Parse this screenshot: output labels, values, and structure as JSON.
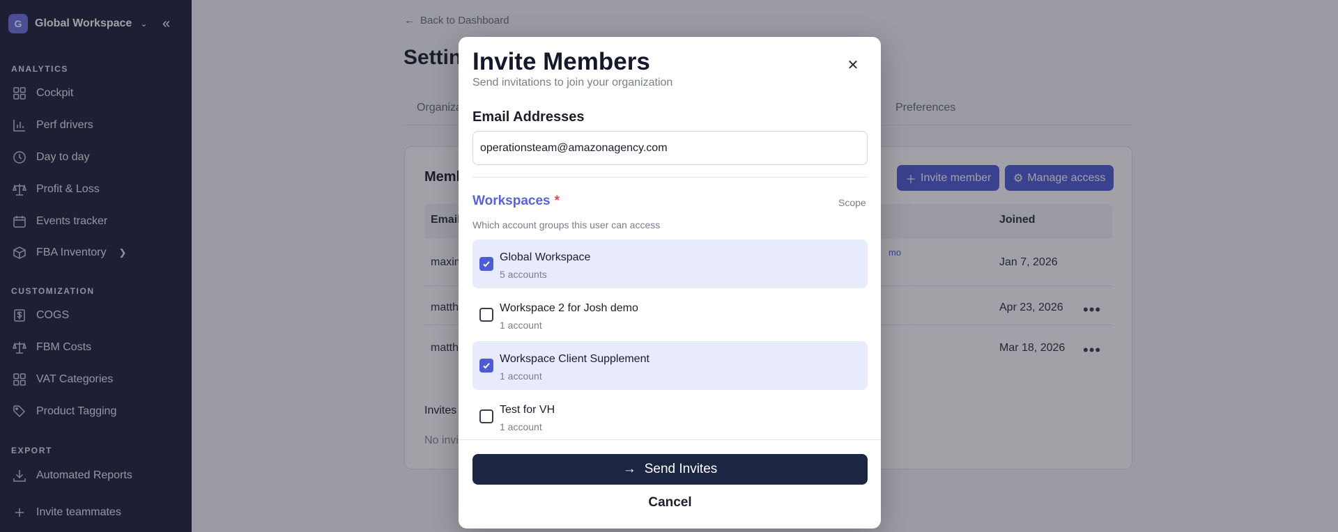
{
  "sidebar": {
    "workspace": {
      "initial": "G",
      "name": "Global Workspace"
    },
    "sections": [
      {
        "label": "ANALYTICS",
        "items": [
          {
            "label": "Cockpit",
            "icon": "grid-icon"
          },
          {
            "label": "Perf drivers",
            "icon": "bar-chart-icon"
          },
          {
            "label": "Day to day",
            "icon": "clock-icon"
          },
          {
            "label": "Profit & Loss",
            "icon": "scale-icon"
          },
          {
            "label": "Events tracker",
            "icon": "calendar-icon"
          },
          {
            "label": "FBA Inventory",
            "icon": "box-icon"
          }
        ]
      },
      {
        "label": "CUSTOMIZATION",
        "items": [
          {
            "label": "COGS",
            "icon": "dollar-icon"
          },
          {
            "label": "FBM Costs",
            "icon": "scale-icon"
          },
          {
            "label": "VAT Categories",
            "icon": "grid-icon"
          },
          {
            "label": "Product Tagging",
            "icon": "tag-icon"
          }
        ]
      },
      {
        "label": "EXPORT",
        "items": [
          {
            "label": "Automated Reports",
            "icon": "download-icon"
          }
        ]
      }
    ],
    "footer": {
      "label": "Invite teammates",
      "icon": "plus-icon"
    }
  },
  "page": {
    "back_link": "Back to Dashboard",
    "title": "Setting",
    "tabs": [
      "Organiza",
      "Preferences"
    ],
    "card": {
      "title": "Memb",
      "invite_button": "Invite member",
      "manage_button": "Manage access",
      "columns": [
        "Email",
        "Joined"
      ],
      "rows": [
        {
          "email": "maxim",
          "link": "mo",
          "joined": "Jan 7, 2026"
        },
        {
          "email": "matth",
          "joined": "Apr 23, 2026"
        },
        {
          "email": "matth",
          "joined": "Mar 18, 2026"
        }
      ],
      "invites_label": "Invites",
      "no_invites": "No invi"
    }
  },
  "modal": {
    "title": "Invite Members",
    "subtitle": "Send invitations to join your organization",
    "email_label": "Email Addresses",
    "email_value": "operationsteam@amazonagency.com",
    "workspaces_label": "Workspaces",
    "required_mark": "*",
    "scope": "Scope",
    "workspaces_help": "Which account groups this user can access",
    "workspaces": [
      {
        "name": "Global Workspace",
        "count": "5 accounts",
        "checked": true
      },
      {
        "name": "Workspace 2 for Josh demo",
        "count": "1 account",
        "checked": false
      },
      {
        "name": "Workspace Client Supplement",
        "count": "1 account",
        "checked": true
      },
      {
        "name": "Test for VH",
        "count": "1 account",
        "checked": false
      }
    ],
    "send_button": "Send Invites",
    "cancel_button": "Cancel"
  }
}
